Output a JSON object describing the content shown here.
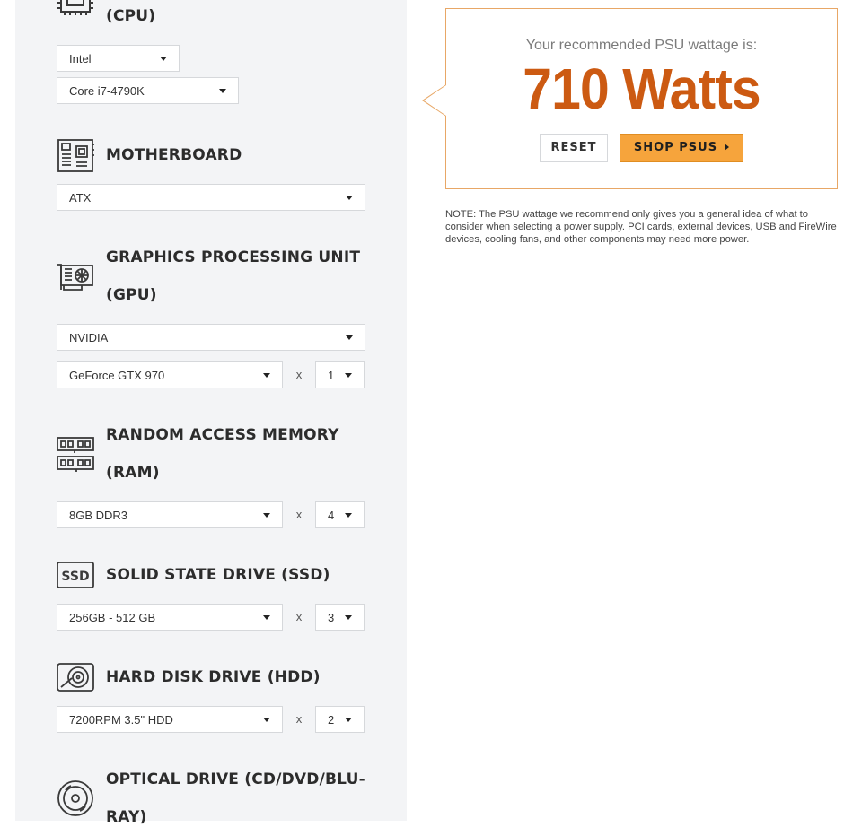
{
  "cpu": {
    "title_suffix": "(CPU)",
    "brand": "Intel",
    "model": "Core i7-4790K"
  },
  "motherboard": {
    "title": "MOTHERBOARD",
    "form_factor": "ATX"
  },
  "gpu": {
    "title_line1": "GRAPHICS PROCESSING UNIT",
    "title_line2": "(GPU)",
    "brand": "NVIDIA",
    "model": "GeForce GTX 970",
    "qty": "1"
  },
  "ram": {
    "title_line1": "RANDOM ACCESS MEMORY",
    "title_line2": "(RAM)",
    "module": "8GB DDR3",
    "qty": "4"
  },
  "ssd": {
    "title": "SOLID STATE DRIVE (SSD)",
    "capacity": "256GB - 512 GB",
    "qty": "3"
  },
  "hdd": {
    "title": "HARD DISK DRIVE (HDD)",
    "type": "7200RPM 3.5\" HDD",
    "qty": "2"
  },
  "optical": {
    "title_line1": "OPTICAL DRIVE (CD/DVD/BLU-",
    "title_line2": "RAY)"
  },
  "multiply_sign": "x",
  "result": {
    "label": "Your recommended PSU wattage is:",
    "wattage": "710 Watts",
    "reset_label": "RESET",
    "shop_label": "SHOP PSUS",
    "accent_color": "#cc5a12",
    "button_color": "#f6a43c"
  },
  "note": "NOTE: The PSU wattage we recommend only gives you a general idea of what to consider when selecting a power supply. PCI cards, external devices, USB and FireWire devices, cooling fans, and other components may need more power.",
  "icons": [
    "cpu-icon",
    "motherboard-icon",
    "gpu-icon",
    "ram-icon",
    "ssd-icon",
    "hdd-icon",
    "optical-drive-icon"
  ]
}
